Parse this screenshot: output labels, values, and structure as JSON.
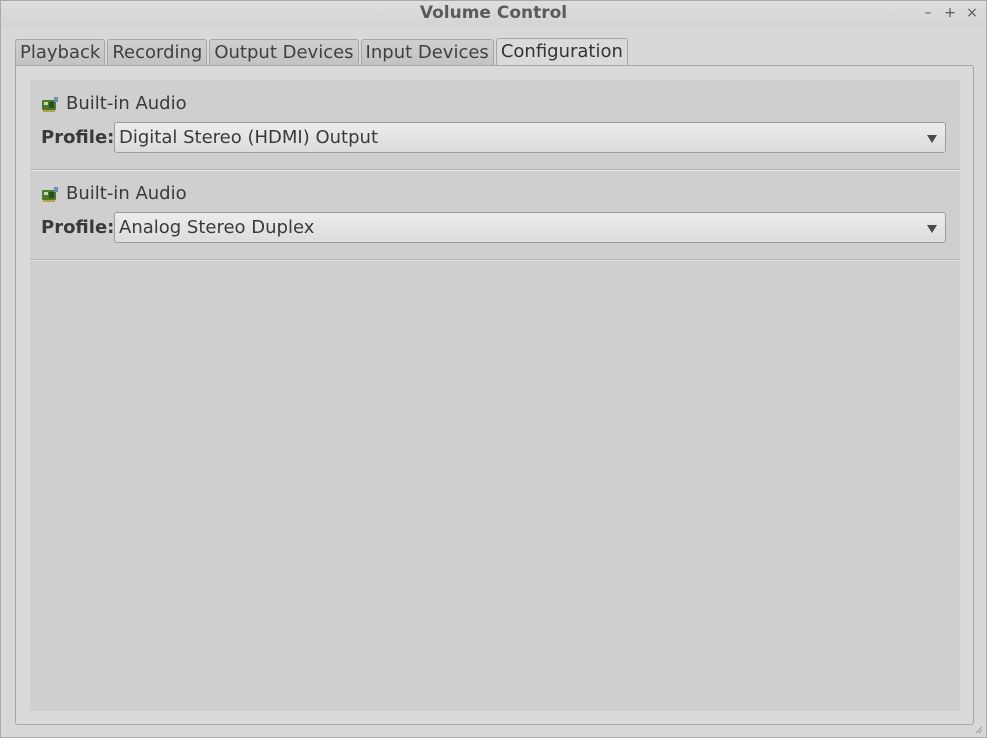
{
  "window": {
    "title": "Volume Control",
    "controls": {
      "minimize": "–",
      "maximize": "+",
      "close": "×"
    }
  },
  "tabs": [
    {
      "label": "Playback",
      "active": false
    },
    {
      "label": "Recording",
      "active": false
    },
    {
      "label": "Output Devices",
      "active": false
    },
    {
      "label": "Input Devices",
      "active": false
    },
    {
      "label": "Configuration",
      "active": true
    }
  ],
  "cards": [
    {
      "name": "Built-in Audio",
      "icon": "sound-card-icon",
      "profile_label": "Profile:",
      "profile_value": "Digital Stereo (HDMI) Output"
    },
    {
      "name": "Built-in Audio",
      "icon": "sound-card-icon",
      "profile_label": "Profile:",
      "profile_value": "Analog Stereo Duplex"
    }
  ],
  "colors": {
    "background": "#d8d8d8",
    "content": "#cfcfcf",
    "icon_green": "#4c7a2c"
  }
}
